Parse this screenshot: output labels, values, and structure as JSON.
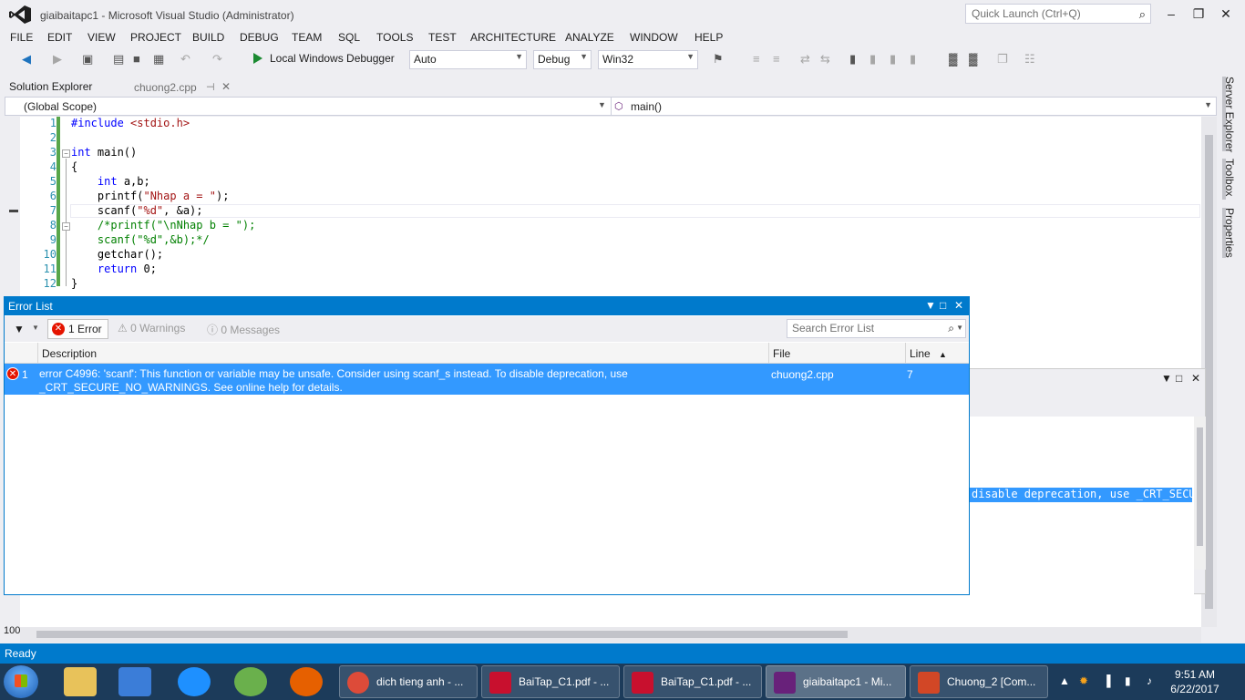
{
  "window": {
    "title": "giaibaitapc1 - Microsoft Visual Studio (Administrator)",
    "quick_launch_placeholder": "Quick Launch (Ctrl+Q)"
  },
  "menu": [
    "FILE",
    "EDIT",
    "VIEW",
    "PROJECT",
    "BUILD",
    "DEBUG",
    "TEAM",
    "SQL",
    "TOOLS",
    "TEST",
    "ARCHITECTURE",
    "ANALYZE",
    "WINDOW",
    "HELP"
  ],
  "toolbar": {
    "debugger_label": "Local Windows Debugger",
    "config_combo": "Auto",
    "build_config": "Debug",
    "platform": "Win32"
  },
  "tabs": {
    "solution_explorer": "Solution Explorer",
    "document": "chuong2.cpp"
  },
  "navbar": {
    "scope": "(Global Scope)",
    "member": "main()"
  },
  "editor": {
    "line_numbers": [
      "1",
      "2",
      "3",
      "4",
      "5",
      "6",
      "7",
      "8",
      "9",
      "10",
      "11",
      "12"
    ],
    "lines": [
      "#include <stdio.h>",
      "",
      "int main()",
      "{",
      "    int a,b;",
      "    printf(\"Nhap a = \");",
      "    scanf(\"%d\", &a);",
      "    /*printf(\"\\nNhap b = \");",
      "    scanf(\"%d\",&b);*/",
      "    getchar();",
      "    return 0;",
      "}"
    ],
    "zoom": "100"
  },
  "right_tabs": [
    "Server Explorer",
    "Toolbox",
    "Properties"
  ],
  "output": {
    "selected_text": "disable deprecation, use _CRT_SECURE_NO_WARNINGS"
  },
  "error_list": {
    "title": "Error List",
    "errors_btn": "1 Error",
    "warnings_btn": "0 Warnings",
    "messages_btn": "0 Messages",
    "search_placeholder": "Search Error List",
    "columns": {
      "description": "Description",
      "file": "File",
      "line": "Line"
    },
    "rows": [
      {
        "num": "1",
        "description": "error C4996: 'scanf': This function or variable may be unsafe. Consider using scanf_s instead. To disable deprecation, use _CRT_SECURE_NO_WARNINGS. See online help for details.",
        "file": "chuong2.cpp",
        "line": "7"
      }
    ]
  },
  "status": {
    "text": "Ready"
  },
  "taskbar": {
    "tasks": [
      {
        "label": "dich tieng anh - ...",
        "color": "#dd4b39"
      },
      {
        "label": "BaiTap_C1.pdf - ...",
        "color": "#c8102e"
      },
      {
        "label": "BaiTap_C1.pdf - ...",
        "color": "#c8102e"
      },
      {
        "label": "giaibaitapc1 - Mi...",
        "color": "#68217a"
      },
      {
        "label": "Chuong_2 [Com...",
        "color": "#d24726"
      }
    ],
    "time": "9:51 AM",
    "date": "6/22/2017"
  }
}
